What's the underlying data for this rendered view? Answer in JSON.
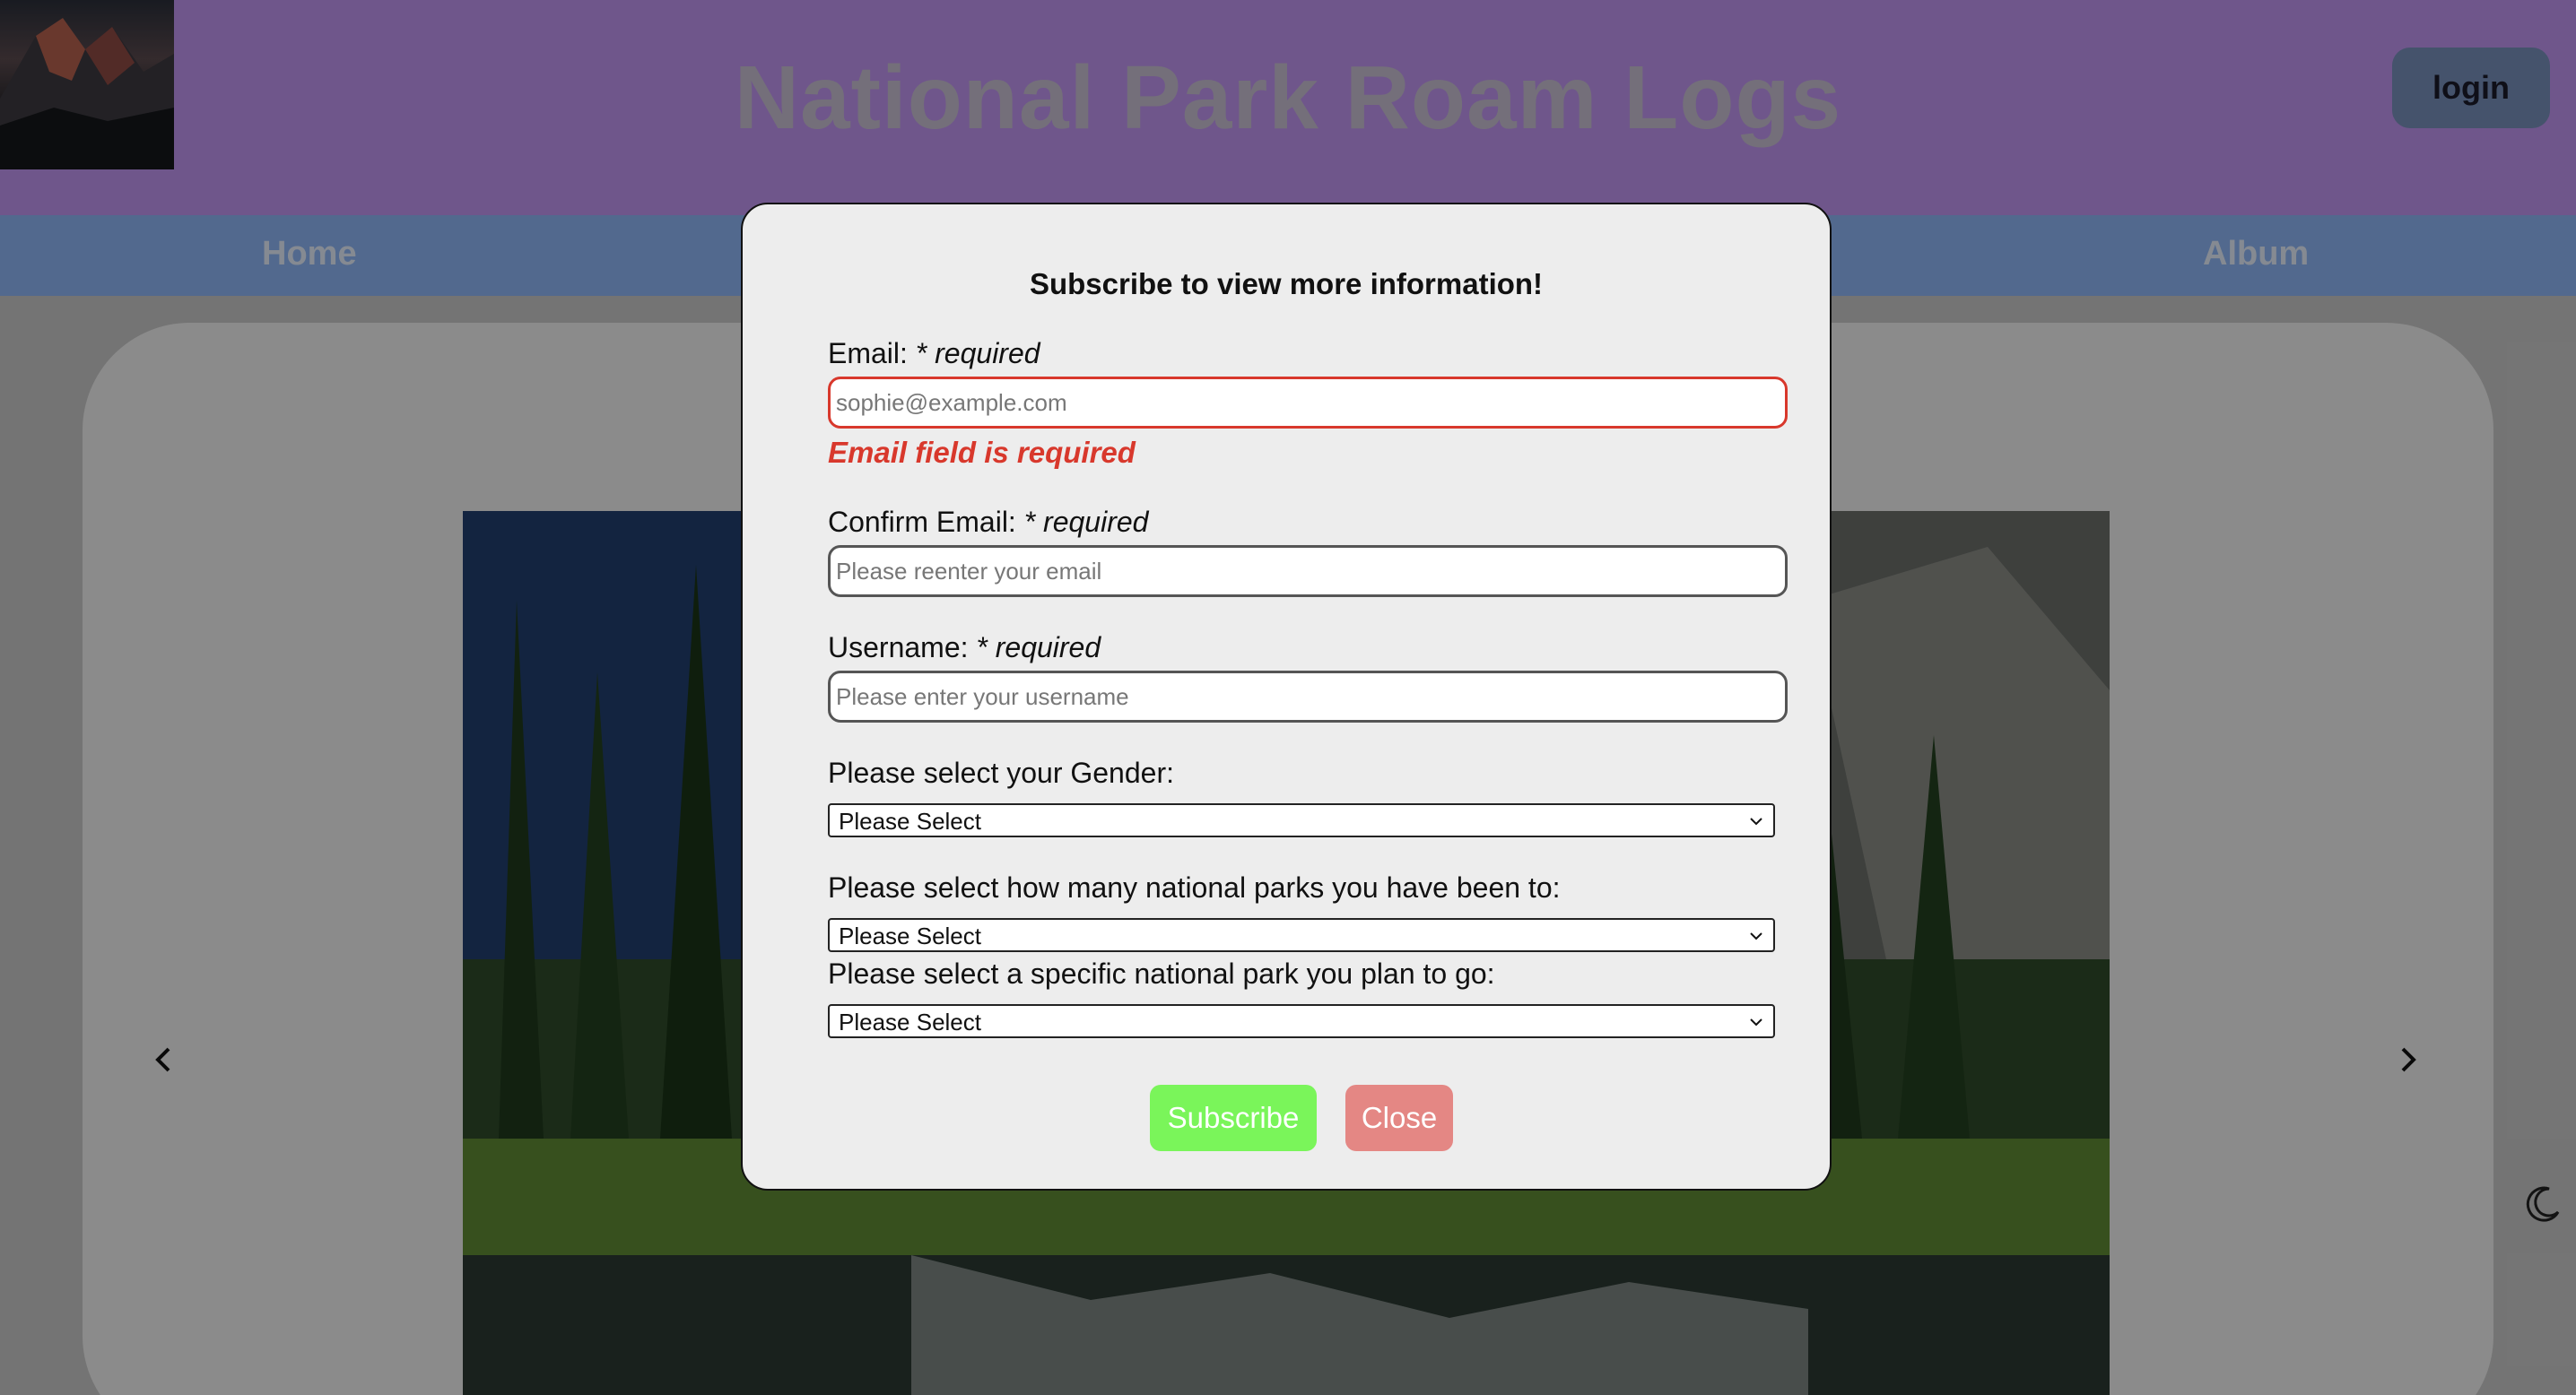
{
  "header": {
    "title": "National Park Roam Logs",
    "login_label": "login"
  },
  "nav": {
    "items": [
      {
        "label": "Home"
      },
      {
        "label": "Album"
      }
    ]
  },
  "carousel": {
    "prev_icon": "chevron-left-icon",
    "next_icon": "chevron-right-icon"
  },
  "theme_toggle": {
    "icon": "moon-icon"
  },
  "modal": {
    "title": "Subscribe to view more information!",
    "email": {
      "label": "Email:",
      "required": "* required",
      "value": "",
      "placeholder": "sophie@example.com",
      "error": "Email field is required"
    },
    "confirm_email": {
      "label": "Confirm Email:",
      "required": "* required",
      "value": "",
      "placeholder": "Please reenter your email"
    },
    "username": {
      "label": "Username:",
      "required": "* required",
      "value": "",
      "placeholder": "Please enter your username"
    },
    "gender": {
      "label": "Please select your Gender:",
      "selected": "Please Select"
    },
    "parks_count": {
      "label": "Please select how many national parks you have been to:",
      "selected": "Please Select"
    },
    "planned_park": {
      "label": "Please select a specific national park you plan to go:",
      "selected": "Please Select"
    },
    "subscribe_label": "Subscribe",
    "close_label": "Close"
  },
  "colors": {
    "header_bg": "#bf95ef",
    "nav_bg": "#8eb5f5",
    "error": "#d8382c",
    "subscribe": "#7af55a",
    "close": "#e48784"
  }
}
